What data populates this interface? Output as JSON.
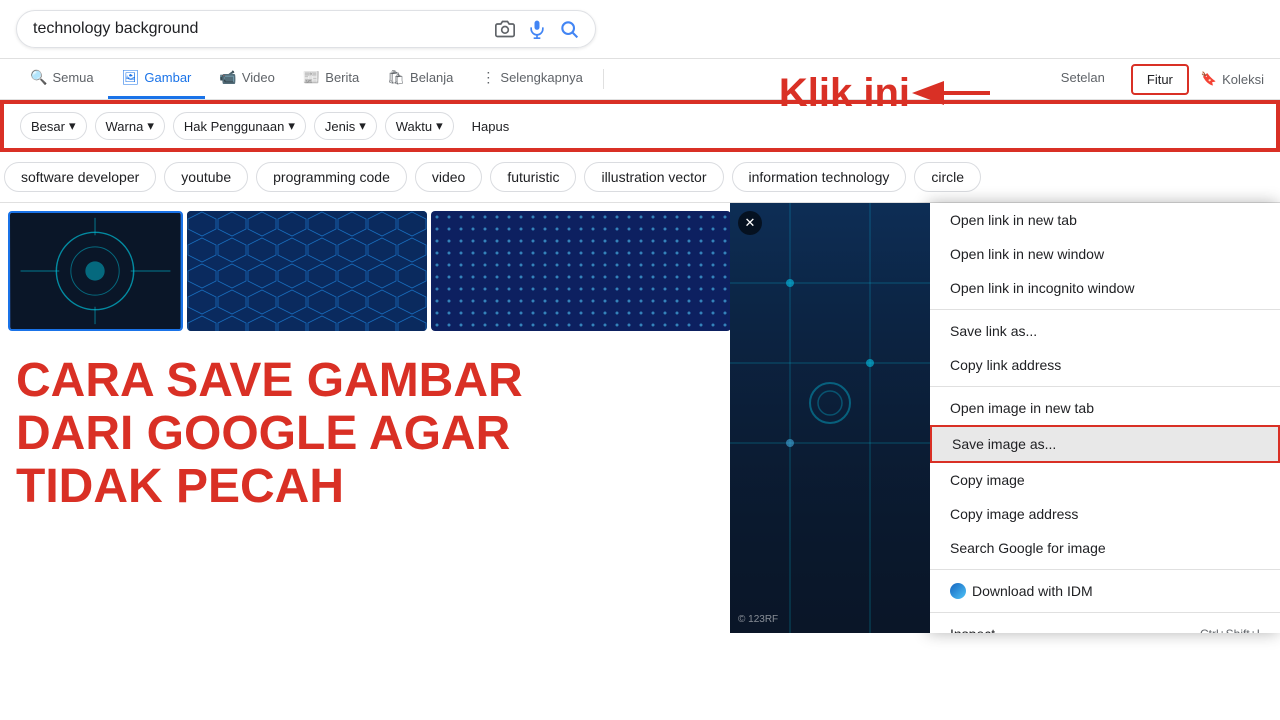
{
  "search": {
    "query": "technology background",
    "placeholder": "technology background"
  },
  "nav": {
    "tabs": [
      {
        "label": "Semua",
        "icon": "🔍",
        "active": false
      },
      {
        "label": "Gambar",
        "icon": "🖼",
        "active": true
      },
      {
        "label": "Video",
        "icon": "📹",
        "active": false
      },
      {
        "label": "Berita",
        "icon": "📰",
        "active": false
      },
      {
        "label": "Belanja",
        "icon": "🛍",
        "active": false
      },
      {
        "label": "Selengkapnya",
        "icon": "⋮",
        "active": false
      }
    ],
    "setelan": "Setelan",
    "fitur": "Fitur",
    "koleksi": "Koleksi"
  },
  "filters": {
    "items": [
      "Besar ▾",
      "Warna ▾",
      "Hak Penggunaan ▾",
      "Jenis ▾",
      "Waktu ▾",
      "Hapus"
    ]
  },
  "chips": [
    "software developer",
    "youtube",
    "programming code",
    "video",
    "futuristic",
    "illustration vector",
    "information technology",
    "circle"
  ],
  "annotation": {
    "klik_ini": "Klik ini"
  },
  "instruction": {
    "line1": "CARA SAVE GAMBAR",
    "line2": "DARI GOOGLE AGAR",
    "line3": "TIDAK PECAH"
  },
  "context_menu": {
    "items": [
      {
        "label": "Open link in new tab",
        "shortcut": ""
      },
      {
        "label": "Open link in new window",
        "shortcut": ""
      },
      {
        "label": "Open link in incognito window",
        "shortcut": ""
      },
      {
        "label": "---",
        "shortcut": ""
      },
      {
        "label": "Save link as...",
        "shortcut": ""
      },
      {
        "label": "Copy link address",
        "shortcut": ""
      },
      {
        "label": "---",
        "shortcut": ""
      },
      {
        "label": "Open image in new tab",
        "shortcut": ""
      },
      {
        "label": "Save image as...",
        "shortcut": "",
        "highlighted": true
      },
      {
        "label": "Copy image",
        "shortcut": ""
      },
      {
        "label": "Copy image address",
        "shortcut": ""
      },
      {
        "label": "Search Google for image",
        "shortcut": ""
      },
      {
        "label": "---",
        "shortcut": ""
      },
      {
        "label": "Download with IDM",
        "shortcut": ""
      },
      {
        "label": "---",
        "shortcut": ""
      },
      {
        "label": "Inspect",
        "shortcut": "Ctrl+Shift+I"
      }
    ]
  },
  "watermark": "© 123RF",
  "close_icon": "✕"
}
